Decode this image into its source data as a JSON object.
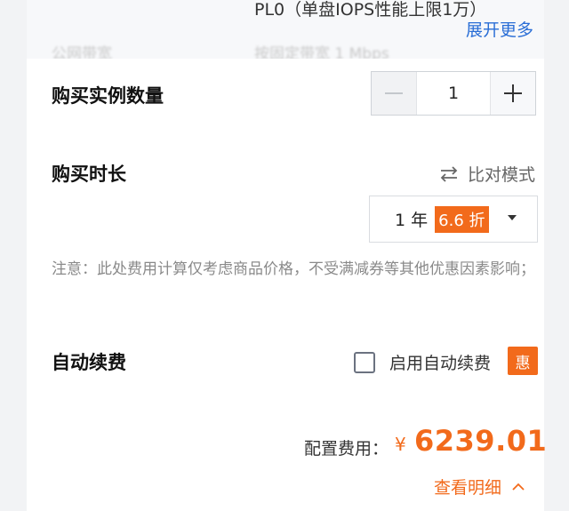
{
  "top": {
    "spec_line": "PL0（单盘IOPS性能上限1万）",
    "expand_link": "展开更多",
    "faded_left": "公网带宽",
    "faded_right": "按固定带宽 1 Mbps"
  },
  "quantity": {
    "label": "购买实例数量",
    "value": "1"
  },
  "duration": {
    "label": "购买时长",
    "compare_label": "比对模式",
    "selected": "1 年",
    "discount": "6.6 折"
  },
  "note": "注意：此处费用计算仅考虑商品价格，不受满减券等其他优惠因素影响；",
  "auto_renew": {
    "label": "自动续费",
    "checkbox_label": "启用自动续费",
    "badge": "惠",
    "checked": false
  },
  "footer": {
    "fee_label": "配置费用：",
    "currency": "¥",
    "fee_value": "6239.01",
    "detail_link": "查看明细"
  },
  "colors": {
    "accent_orange": "#f26a1b",
    "link_blue": "#2a6ed6"
  }
}
